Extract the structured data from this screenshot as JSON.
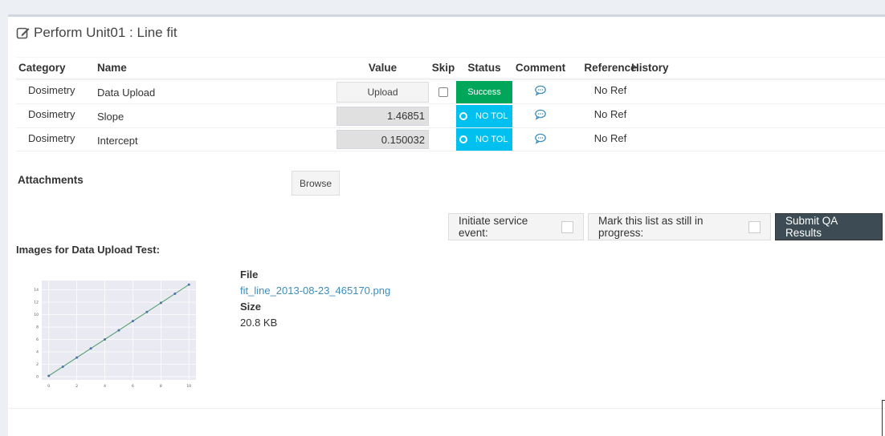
{
  "page": {
    "title": "Perform Unit01 : Line fit",
    "title_icon": "edit-icon"
  },
  "table": {
    "headers": {
      "category": "Category",
      "name": "Name",
      "value": "Value",
      "skip": "Skip",
      "status": "Status",
      "comment": "Comment",
      "reference": "Reference",
      "history": "History"
    },
    "rows": [
      {
        "category": "Dosimetry",
        "name": "Data Upload",
        "value": "Upload",
        "status": "Success",
        "reference": "No Ref"
      },
      {
        "category": "Dosimetry",
        "name": "Slope",
        "value": "1.46851",
        "status": "NO TOL",
        "reference": "No Ref"
      },
      {
        "category": "Dosimetry",
        "name": "Intercept",
        "value": "0.150032",
        "status": "NO TOL",
        "reference": "No Ref"
      }
    ]
  },
  "attachments": {
    "label": "Attachments",
    "browse_label": "Browse"
  },
  "actions": {
    "initiate_service": "Initiate service event:",
    "mark_in_progress": "Mark this list as still in progress:",
    "submit": "Submit QA Results"
  },
  "images": {
    "label": "Images for Data Upload Test:",
    "file_label": "File",
    "file_name": "fit_line_2013-08-23_465170.png",
    "size_label": "Size",
    "size_value": "20.8 KB"
  },
  "chart_data": {
    "type": "line",
    "x": [
      0,
      1,
      2,
      3,
      4,
      5,
      6,
      7,
      8,
      9,
      10
    ],
    "series": [
      {
        "values": [
          0.15,
          1.62,
          3.09,
          4.56,
          6.02,
          7.49,
          8.96,
          10.43,
          11.9,
          13.37,
          14.84
        ]
      }
    ],
    "xticks": [
      "0",
      "2",
      "4",
      "6",
      "8",
      "10"
    ],
    "yticks": [
      "0",
      "2",
      "4",
      "6",
      "8",
      "10",
      "12",
      "14"
    ],
    "xlim": [
      -0.5,
      10.5
    ],
    "ylim": [
      -0.5,
      15.5
    ],
    "grid": true,
    "colors": {
      "line": "#4c9a6b",
      "marker": "#4c72b0",
      "plot_bg": "#eaeaf2",
      "grid": "#ffffff"
    }
  },
  "colors": {
    "success": "#00a65a",
    "no_tol": "#00c0ef",
    "submit": "#3c4b54",
    "link": "#3c8dbc"
  }
}
